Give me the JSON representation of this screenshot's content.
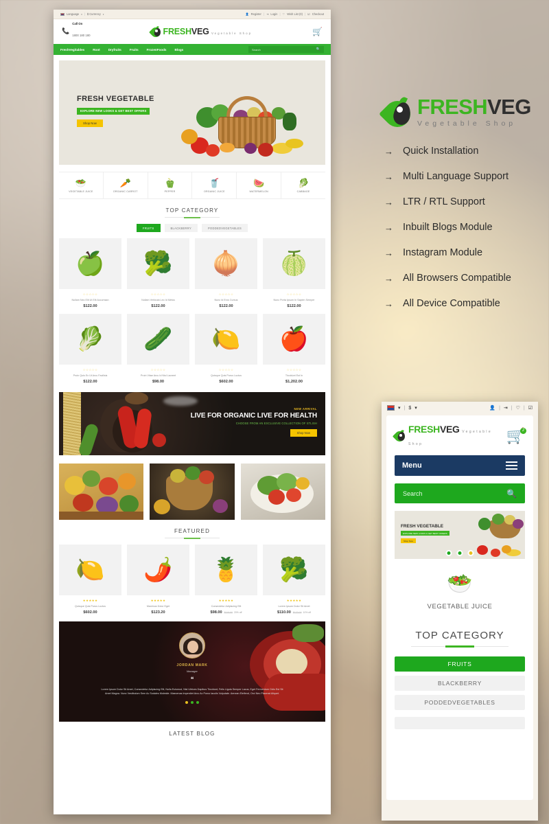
{
  "brand": {
    "name_green": "FRESH",
    "name_dark": "VEG",
    "tagline": "Vegetable Shop"
  },
  "features": {
    "items": [
      {
        "arrow": "→",
        "label": "Quick Installation"
      },
      {
        "arrow": "→",
        "label": "Multi Language Support"
      },
      {
        "arrow": "→",
        "label": "LTR / RTL Support"
      },
      {
        "arrow": "→",
        "label": "Inbuilt Blogs Module"
      },
      {
        "arrow": "→",
        "label": "Instagram Module"
      },
      {
        "arrow": "→",
        "label": "All Browsers Compatible"
      },
      {
        "arrow": "→",
        "label": "All Device Compatible"
      }
    ]
  },
  "desktop": {
    "topbar": {
      "language": "Language",
      "currency": "$ Currency",
      "register": "Register",
      "login": "Login",
      "wishlist": "Wish List (0)",
      "checkout": "Checkout",
      "divider": "|"
    },
    "header": {
      "call_label": "Call On",
      "call_number": "1800 180 180",
      "cart_icon": "cart-icon"
    },
    "nav": {
      "items": [
        "FreshVegitables",
        "Root",
        "Dryfruits",
        "Fruits",
        "FrozenFoods",
        "Blogs"
      ],
      "search_placeholder": "Search",
      "search_icon": "search-icon"
    },
    "hero": {
      "title": "FRESH VEGETABLE",
      "subtitle": "EXPLORE NEW LOOKS & GET BEST OFFERS",
      "button": "Shop Now"
    },
    "categories": [
      {
        "icon": "🥗",
        "label": "VEGETABLE JUICE"
      },
      {
        "icon": "🥕",
        "label": "ORGANIC CARROT"
      },
      {
        "icon": "🫑",
        "label": "PEPPER"
      },
      {
        "icon": "🥤",
        "label": "ORGANIC JUICE"
      },
      {
        "icon": "🍉",
        "label": "WATERMELON"
      },
      {
        "icon": "🥬",
        "label": "CABBAGE"
      }
    ],
    "top_category": {
      "title": "TOP CATEGORY",
      "tabs": [
        {
          "label": "FRUITS",
          "active": true
        },
        {
          "label": "BLACKBERRY",
          "active": false
        },
        {
          "label": "PODDEDVEGETABLES",
          "active": false
        }
      ],
      "products": [
        {
          "icon": "🍏",
          "stars": "☆☆☆☆☆",
          "name": "Nullam Nec Elit Ut Elit Accumsan",
          "price": "$122.00"
        },
        {
          "icon": "🥦",
          "stars": "☆☆☆☆☆",
          "name": "Nullam Vehicula Leo Id Metus",
          "price": "$122.00"
        },
        {
          "icon": "🧅",
          "stars": "☆☆☆☆☆",
          "name": "Nunc Id Eros Cursus",
          "price": "$122.00"
        },
        {
          "icon": "🍈",
          "stars": "☆☆☆☆☆",
          "name": "Nunc Porta Ipsum In Sapien Semper",
          "price": "$122.00"
        },
        {
          "icon": "🥬",
          "stars": "☆☆☆☆☆",
          "name": "Proin Quis Ex Ut Arcu Facilisis",
          "price": "$122.00"
        },
        {
          "icon": "🥒",
          "stars": "☆☆☆☆☆",
          "name": "Proin Vitae Arcu Id Nisl Laoreet",
          "price": "$98.00"
        },
        {
          "icon": "🍋",
          "stars": "☆☆☆☆☆",
          "name": "Quisque Quis Purus Luctus",
          "price": "$602.00"
        },
        {
          "icon": "🍎",
          "stars": "☆☆☆☆☆",
          "name": "Tincidunt Est In",
          "price": "$1,202.00"
        }
      ]
    },
    "banner": {
      "kicker": "NEW ARRIVAL",
      "heading": "LIVE FOR ORGANIC LIVE FOR HEALTH",
      "subheading": "CHOOSE FROM AN EXCLUSIVE COLLECTION OF STLISH",
      "button": "Shop Now"
    },
    "featured": {
      "title": "FEATURED",
      "products": [
        {
          "icon": "🍋",
          "stars": "★★★★★",
          "name": "Quisque Quis Purus Luctus",
          "price": "$602.00",
          "old_price": "",
          "discount": ""
        },
        {
          "icon": "🌶️",
          "stars": "★★★★★",
          "name": "Maximus Dolor Eget",
          "price": "$123.20",
          "old_price": "",
          "discount": ""
        },
        {
          "icon": "🍍",
          "stars": "★★★★★",
          "name": "Consectetur Adipiscing Elit",
          "price": "$98.00",
          "old_price": "$110.00",
          "discount": "20% off"
        },
        {
          "icon": "🥦",
          "stars": "★★★★★",
          "name": "Lorem Ipsum Dolor Sit Amet",
          "price": "$110.00",
          "old_price": "$122.00",
          "discount": "10% off"
        }
      ]
    },
    "testimonial": {
      "name": "JORDAN MARK",
      "role": "Manager",
      "quote_icon": "quote-icon",
      "text": "Lorem Ipsum Dolor Sit Amet, Consectetur Adipiscing Elit, Nulla Euismod, Nisl Ultrices Dapibus Tincidunt, Felis Ligula Semper Lacus, Eget Fermentum Odio Est Sit Amet Magna. Nunc Vestibulum Sem Ac Sodales Molestie. Maecenas Imperdiet Arcu Ac Purus Iaculis Vulputate. Aenean Eleifend, Orci Nec Placerat Aliquet.",
      "dot_colors": [
        "#e8c020",
        "#3cb521",
        "#3cb521"
      ]
    },
    "latest_blog": {
      "title": "LATEST BLOG"
    }
  },
  "mobile": {
    "topbar": {
      "language_icon": "flag-icon",
      "currency": "$",
      "caret": "▾",
      "divider": "|",
      "account_icon": "user-icon",
      "login_icon": "login-icon",
      "wishlist_icon": "heart-icon",
      "checkout_icon": "checkout-icon"
    },
    "header": {
      "cart_icon": "cart-icon",
      "cart_count": "2"
    },
    "menu_button": {
      "label": "Menu",
      "icon": "hamburger-icon"
    },
    "search": {
      "placeholder": "Search",
      "icon": "search-icon"
    },
    "hero": {
      "title": "FRESH VEGETABLE",
      "subtitle": "EXPLORE NEW LOOKS & GET BEST OFFERS",
      "button": "Shop Now",
      "dot_colors": [
        "#1ea81e",
        "#1ea81e",
        "#e8c020"
      ]
    },
    "category": {
      "icon": "🥗",
      "label": "VEGETABLE JUICE"
    },
    "top_category": {
      "title": "TOP CATEGORY",
      "tabs": [
        {
          "label": "FRUITS",
          "active": true
        },
        {
          "label": "BLACKBERRY",
          "active": false
        },
        {
          "label": "PODDEDVEGETABLES",
          "active": false
        }
      ]
    }
  },
  "colors": {
    "brand_green": "#3cb521",
    "nav_green": "#34b233",
    "accent_yellow": "#f5c400",
    "menu_blue": "#1b3a63",
    "gold": "#e0b84a"
  }
}
